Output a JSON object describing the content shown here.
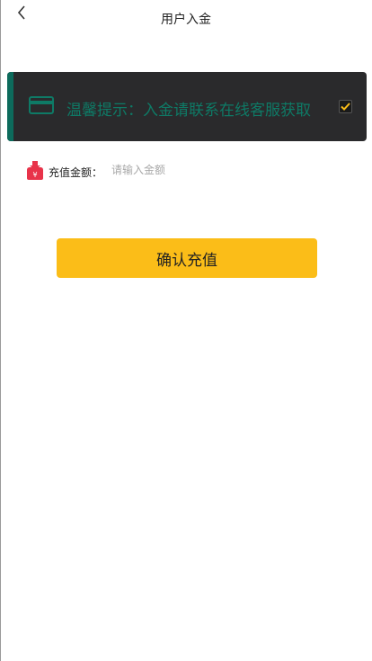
{
  "header": {
    "title": "用户入金",
    "back_icon": "chevron-left-icon"
  },
  "notice": {
    "icon": "credit-card-icon",
    "text": "温馨提示：入金请联系在线客服获取",
    "checked": true,
    "text_color": "#0e7a66",
    "background": "#2a2a2c",
    "accent_color": "#0d6b5c",
    "check_color": "#fbbd18"
  },
  "amount": {
    "icon": "money-pouch-icon",
    "label": "充值金额：",
    "placeholder": "请输入金额",
    "value": ""
  },
  "confirm": {
    "label": "确认充值",
    "color": "#fbbd18"
  }
}
